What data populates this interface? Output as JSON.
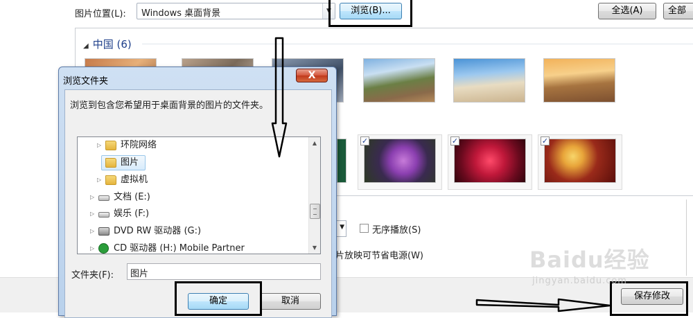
{
  "toolbar": {
    "location_label": "图片位置(L):",
    "location_value": "Windows 桌面背景",
    "browse_label": "浏览(B)...",
    "select_all_label": "全选(A)",
    "clear_all_label": "全部"
  },
  "gallery": {
    "group_label": "中国 (6)",
    "row2_checked": [
      true,
      true,
      true
    ]
  },
  "options": {
    "shuffle_label": "无序播放(S)",
    "powersave_label": "片放映可节省电源(W)"
  },
  "footer": {
    "save_label": "保存修改"
  },
  "dialog": {
    "title": "浏览文件夹",
    "close_glyph": "X",
    "instruction": "浏览到包含您希望用于桌面背景的图片的文件夹。",
    "tree": [
      {
        "label": "环院网络",
        "icon": "folder-icon"
      },
      {
        "label": "图片",
        "icon": "folder-icon"
      },
      {
        "label": "虚拟机",
        "icon": "folder-icon"
      },
      {
        "label": "文档 (E:)",
        "icon": "drive-icon"
      },
      {
        "label": "娱乐 (F:)",
        "icon": "drive-icon"
      },
      {
        "label": "DVD RW 驱动器 (G:)",
        "icon": "dvd-drive-icon"
      },
      {
        "label": "CD 驱动器 (H:) Mobile Partner",
        "icon": "cd-drive-icon"
      }
    ],
    "folder_label": "文件夹(F):",
    "folder_value": "图片",
    "ok_label": "确定",
    "cancel_label": "取消"
  },
  "watermark": {
    "main": "Baidu经验",
    "sub": "jingyan.baidu.com"
  },
  "colors": {
    "accent": "#3c7fb1",
    "group_header": "#1e3f8a",
    "close_button": "#c0391c",
    "annotation": "#000000"
  }
}
